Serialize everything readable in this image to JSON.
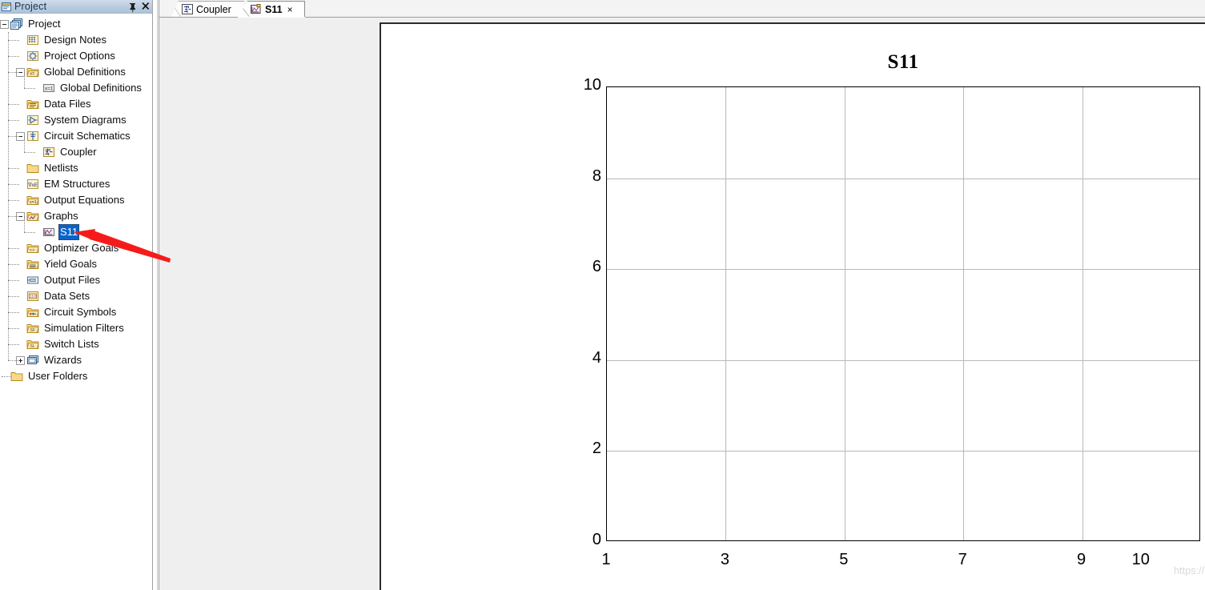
{
  "panel": {
    "title": "Project",
    "title_icon": "project-window-icon",
    "pin_icon": "pin-icon",
    "close_icon": "close-icon"
  },
  "tree": {
    "root": {
      "label": "Project",
      "icon": "project-stack-icon",
      "expander": "minus"
    },
    "items": [
      {
        "label": "Design Notes",
        "icon": "design-notes-icon",
        "indent": 1,
        "expander": "none"
      },
      {
        "label": "Project Options",
        "icon": "project-options-icon",
        "indent": 1,
        "expander": "none"
      },
      {
        "label": "Global Definitions",
        "icon": "global-definitions-folder-icon",
        "indent": 1,
        "expander": "minus"
      },
      {
        "label": "Global Definitions",
        "icon": "variable-xeq1-icon",
        "indent": 2,
        "expander": "none"
      },
      {
        "label": "Data Files",
        "icon": "data-files-folder-icon",
        "indent": 1,
        "expander": "none"
      },
      {
        "label": "System Diagrams",
        "icon": "system-diagrams-icon",
        "indent": 1,
        "expander": "none"
      },
      {
        "label": "Circuit Schematics",
        "icon": "circuit-schematics-icon",
        "indent": 1,
        "expander": "minus"
      },
      {
        "label": "Coupler",
        "icon": "schematic-doc-icon",
        "indent": 2,
        "expander": "none"
      },
      {
        "label": "Netlists",
        "icon": "netlists-folder-icon",
        "indent": 1,
        "expander": "none"
      },
      {
        "label": "EM Structures",
        "icon": "em-structures-icon",
        "indent": 1,
        "expander": "none"
      },
      {
        "label": "Output Equations",
        "icon": "output-equations-icon",
        "indent": 1,
        "expander": "none"
      },
      {
        "label": "Graphs",
        "icon": "graphs-folder-icon",
        "indent": 1,
        "expander": "minus"
      },
      {
        "label": "S11",
        "icon": "graph-doc-icon",
        "indent": 2,
        "expander": "none",
        "selected": true
      },
      {
        "label": "Optimizer Goals",
        "icon": "optimizer-goals-icon",
        "indent": 1,
        "expander": "none"
      },
      {
        "label": "Yield Goals",
        "icon": "yield-goals-icon",
        "indent": 1,
        "expander": "none"
      },
      {
        "label": "Output Files",
        "icon": "output-files-icon",
        "indent": 1,
        "expander": "none"
      },
      {
        "label": "Data Sets",
        "icon": "data-sets-icon",
        "indent": 1,
        "expander": "none"
      },
      {
        "label": "Circuit Symbols",
        "icon": "circuit-symbols-icon",
        "indent": 1,
        "expander": "none"
      },
      {
        "label": "Simulation Filters",
        "icon": "simulation-filters-icon",
        "indent": 1,
        "expander": "none"
      },
      {
        "label": "Switch Lists",
        "icon": "switch-lists-icon",
        "indent": 1,
        "expander": "none"
      },
      {
        "label": "Wizards",
        "icon": "wizards-icon",
        "indent": 1,
        "expander": "plus"
      },
      {
        "label": "User Folders",
        "icon": "user-folders-icon",
        "indent": 0,
        "expander": "none"
      }
    ]
  },
  "tabs": [
    {
      "label": "Coupler",
      "icon": "schematic-tab-icon",
      "active": false,
      "closable": false
    },
    {
      "label": "S11",
      "icon": "graph-tab-icon",
      "active": true,
      "closable": true,
      "close_label": "×"
    }
  ],
  "watermark": "https://blog.csdn.net/kexuedalao",
  "annotation": {
    "shape": "red-arrow",
    "color": "#f61b1b"
  },
  "chart_data": {
    "type": "line",
    "title": "S11",
    "xlabel": "",
    "ylabel": "",
    "series": [],
    "x": [],
    "xlim": [
      1,
      11
    ],
    "ylim": [
      0,
      10
    ],
    "xticks": [
      1,
      3,
      5,
      7,
      9,
      10
    ],
    "xticklabels": [
      "1",
      "3",
      "5",
      "7",
      "9",
      "10"
    ],
    "yticks": [
      0,
      2,
      4,
      6,
      8,
      10
    ],
    "yticklabels": [
      "0",
      "2",
      "4",
      "6",
      "8",
      "10"
    ],
    "grid": true,
    "gridlines_x": [
      3,
      5,
      7,
      9,
      11
    ],
    "gridlines_y": [
      2,
      4,
      6,
      8
    ],
    "legend": null,
    "plot_bg": "#ffffff",
    "grid_color": "#b8b8b8",
    "axis_color": "#000000"
  }
}
